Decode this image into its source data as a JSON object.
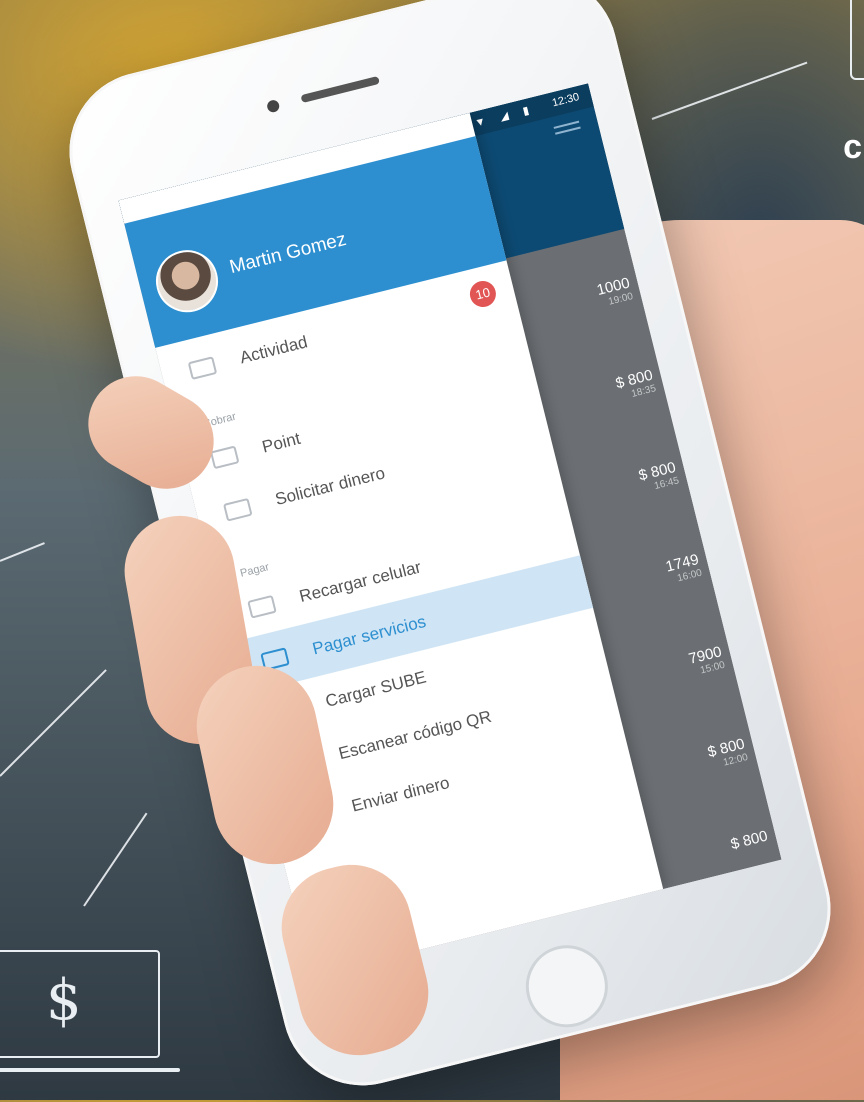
{
  "status_bar": {
    "icons": "▼ ◢ ▮",
    "time": "12:30"
  },
  "user": {
    "name": "Martin Gomez"
  },
  "menu": {
    "activity": {
      "label": "Actividad",
      "badge": "10"
    },
    "section_cobrar": "Cobrar",
    "cobrar_items": [
      "Point",
      "Solicitar dinero"
    ],
    "section_pagar": "Pagar",
    "pagar_items": [
      "Recargar celular",
      "Pagar servicios",
      "Cargar SUBE",
      "Escanear código QR",
      "Enviar dinero"
    ],
    "active_item": "Pagar servicios"
  },
  "background_list": {
    "amounts": [
      "1000",
      "$ 800",
      "$ 800",
      "1749",
      "7900",
      "$ 800",
      "$ 800"
    ]
  },
  "corner_text": "c",
  "dollar_symbol": "$",
  "colors": {
    "brand_blue": "#2d8fd0",
    "dark_blue": "#0d4a73",
    "badge_red": "#e25555",
    "active_bg": "#cfe4f4"
  }
}
